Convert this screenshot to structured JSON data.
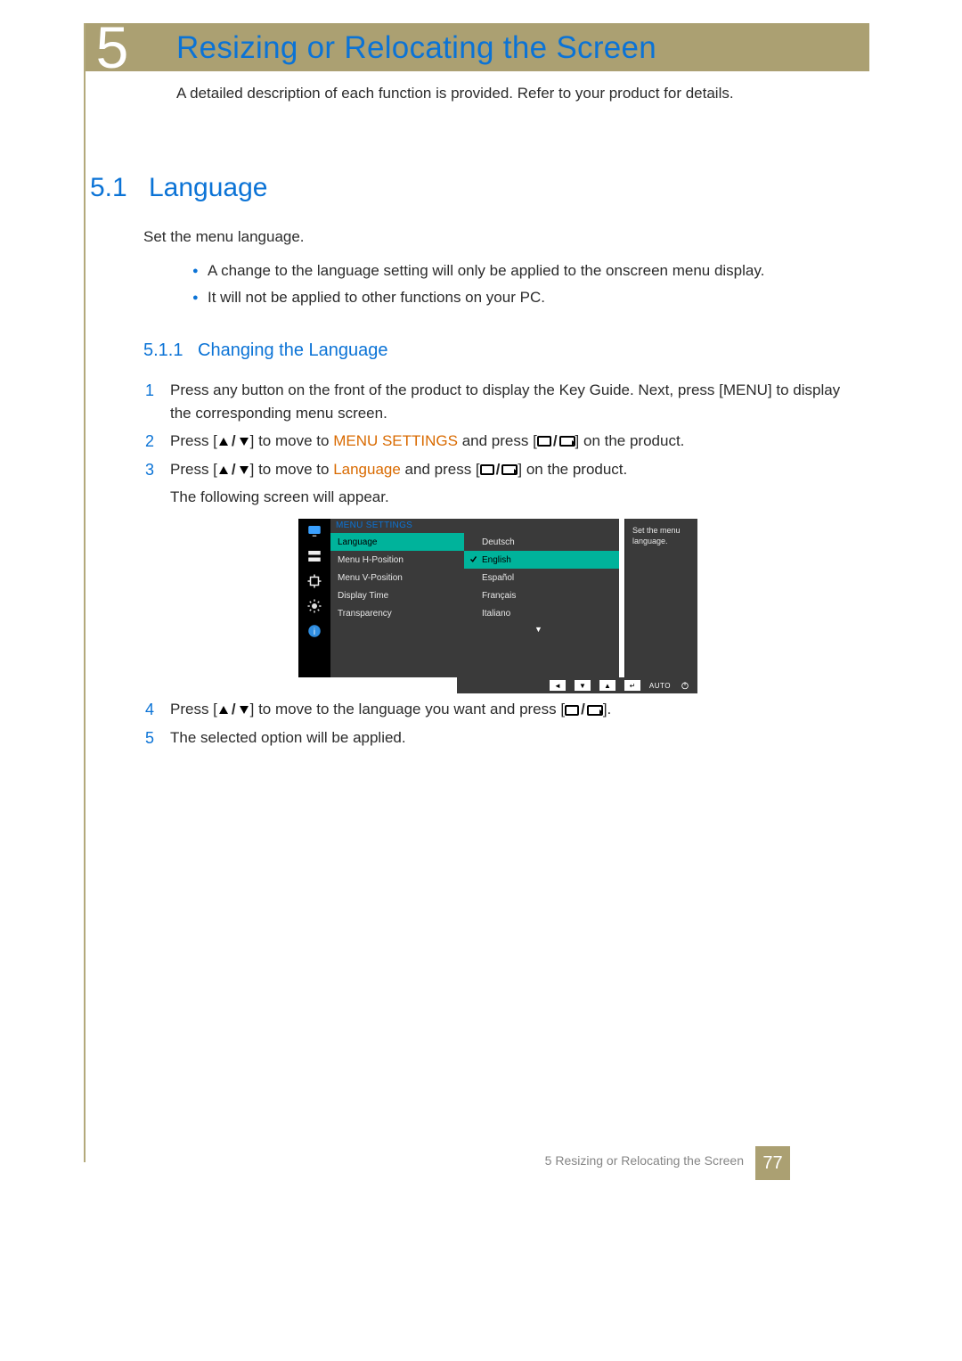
{
  "header": {
    "chapter_number": "5",
    "title": "Resizing or Relocating the Screen",
    "intro": "A detailed description of each function is provided. Refer to your product for details."
  },
  "section": {
    "number": "5.1",
    "title": "Language",
    "lead": "Set the menu language.",
    "bullets": [
      "A change to the language setting will only be applied to the onscreen menu display.",
      "It will not be applied to other functions on your PC."
    ]
  },
  "subsection": {
    "number": "5.1.1",
    "title": "Changing the Language"
  },
  "steps": {
    "s1_a": "Press any button on the front of the product to display the Key Guide. Next, press [",
    "s1_menu": "MENU",
    "s1_b": "] to display the corresponding menu screen.",
    "s2_a": "Press [",
    "s2_b": "] to move to ",
    "s2_target": "MENU SETTINGS",
    "s2_c": " and press [",
    "s2_d": "] on the product.",
    "s3_a": "Press [",
    "s3_b": "] to move to ",
    "s3_target": "Language",
    "s3_c": " and press [",
    "s3_d": "] on the product.",
    "s3_e": "The following screen will appear.",
    "s4_a": "Press [",
    "s4_b": "] to move to the language you want and press [",
    "s4_c": "].",
    "s5": "The selected option will be applied."
  },
  "osd": {
    "title": "MENU SETTINGS",
    "left": [
      "Language",
      "Menu H-Position",
      "Menu V-Position",
      "Display Time",
      "Transparency"
    ],
    "right": [
      "Deutsch",
      "English",
      "Español",
      "Français",
      "Italiano"
    ],
    "help": "Set the menu language.",
    "auto": "AUTO"
  },
  "footer": {
    "text": "5 Resizing or Relocating the Screen",
    "page": "77"
  }
}
